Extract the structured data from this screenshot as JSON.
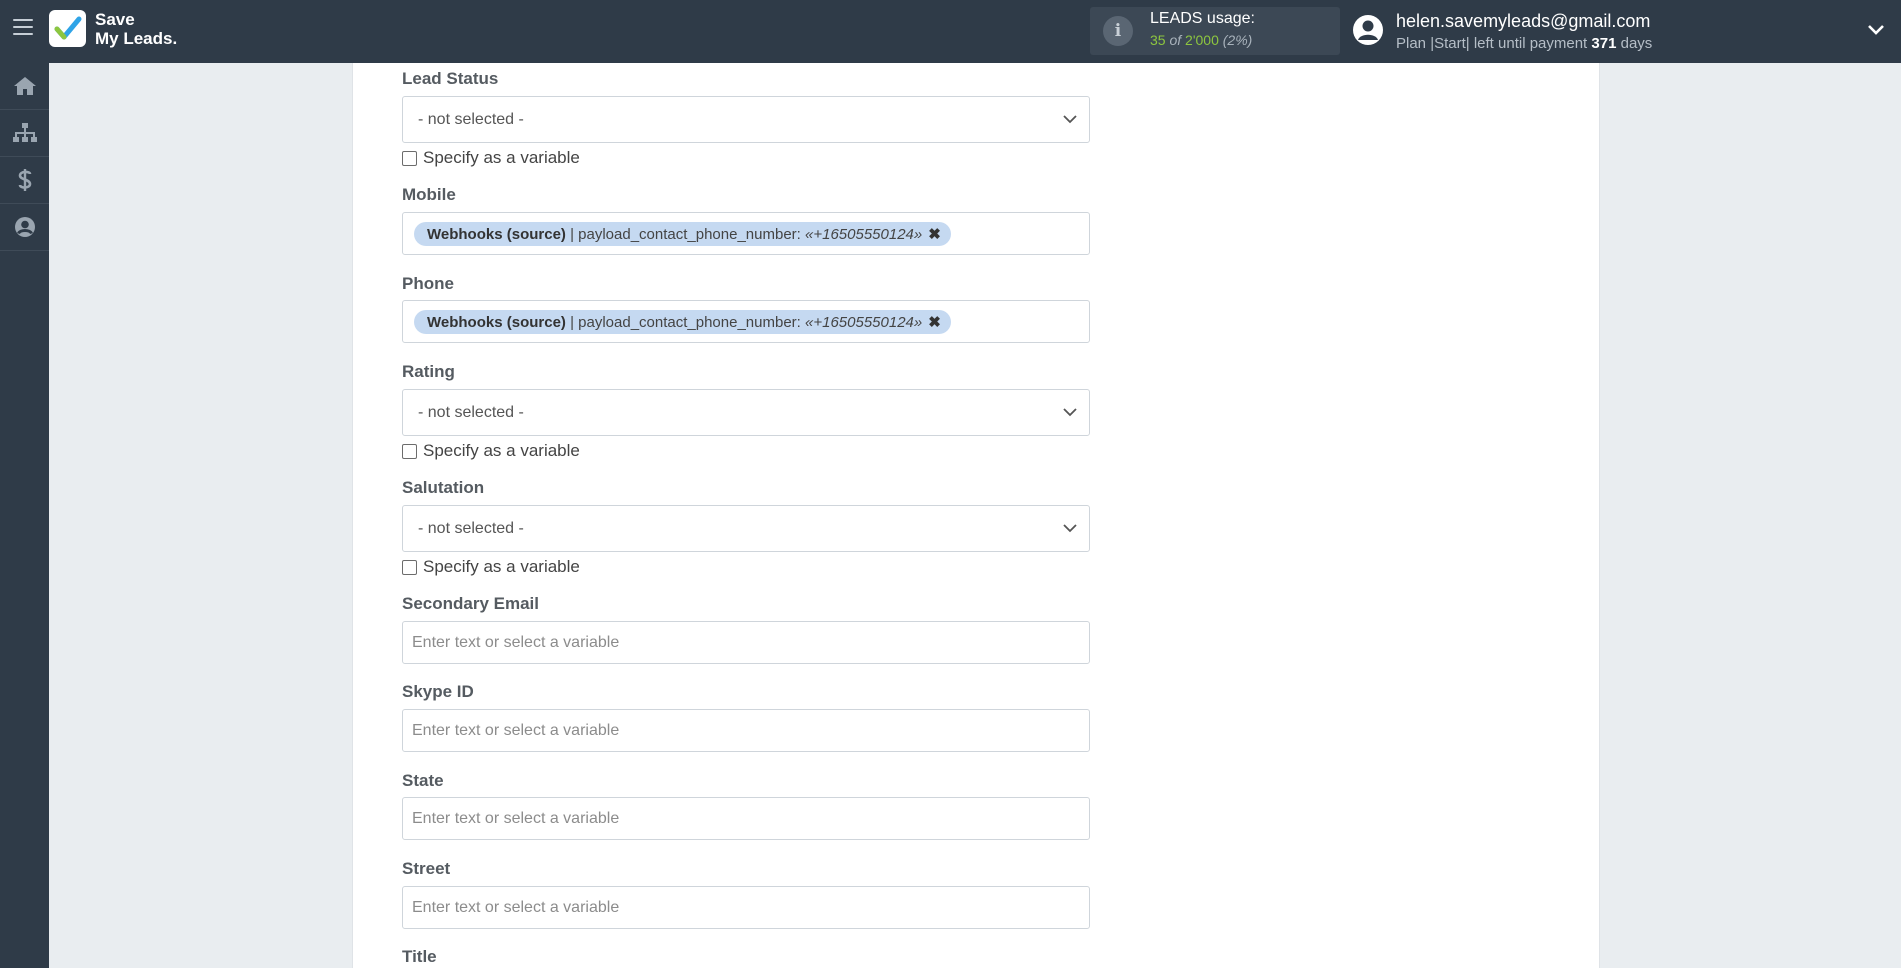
{
  "header": {
    "logo_line1": "Save",
    "logo_line2": "My Leads.",
    "leads_label": "LEADS usage:",
    "leads_used": "35",
    "leads_of": "of",
    "leads_total": "2'000",
    "leads_pct": "(2%)",
    "user_email": "helen.savemyleads@gmail.com",
    "plan_text": "Plan |Start| left until payment",
    "days_left": "371",
    "days_word": "days"
  },
  "sidebar": {
    "items": [
      {
        "icon": "home-icon"
      },
      {
        "icon": "sitemap-icon"
      },
      {
        "icon": "dollar-icon"
      },
      {
        "icon": "user-icon"
      }
    ]
  },
  "form": {
    "checkbox_label": "Specify as a variable",
    "placeholder": "Enter text or select a variable",
    "fields": {
      "lead_status": {
        "label": "Lead Status",
        "value": "- not selected -"
      },
      "mobile": {
        "label": "Mobile",
        "tag_source": "Webhooks (source)",
        "tag_field": "| payload_contact_phone_number:",
        "tag_value": "«+16505550124»"
      },
      "phone": {
        "label": "Phone",
        "tag_source": "Webhooks (source)",
        "tag_field": "| payload_contact_phone_number:",
        "tag_value": "«+16505550124»"
      },
      "rating": {
        "label": "Rating",
        "value": "- not selected -"
      },
      "salutation": {
        "label": "Salutation",
        "value": "- not selected -"
      },
      "secondary_email": {
        "label": "Secondary Email"
      },
      "skype_id": {
        "label": "Skype ID"
      },
      "state": {
        "label": "State"
      },
      "street": {
        "label": "Street"
      },
      "title": {
        "label": "Title"
      }
    }
  },
  "colors": {
    "topbar": "#2f3b48",
    "tag_bg": "#c5d9f1",
    "accent_green": "#8dc63f"
  }
}
